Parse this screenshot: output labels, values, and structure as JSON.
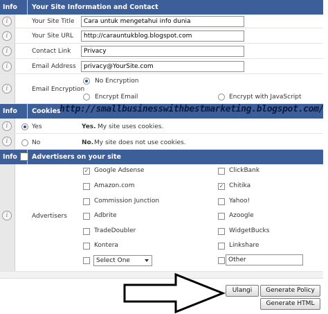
{
  "site_info": {
    "header_info": "Info",
    "header_title": "Your Site Information and Contact",
    "site_title_label": "Your Site Title",
    "site_title_value": "Cara untuk mengetahui info dunia",
    "site_url_label": "Your Site URL",
    "site_url_value": "http://carauntukblog.blogspot.com",
    "contact_link_label": "Contact Link",
    "contact_link_value": "Privacy",
    "email_label": "Email Address",
    "email_value": "privacy@YourSite.com",
    "encryption_label": "Email Encryption",
    "encryption_options": [
      "No Encryption",
      "Encrypt Email",
      "Encrypt with JavaScript"
    ],
    "encryption_selected": "No Encryption"
  },
  "cookies": {
    "header_info": "Info",
    "header_title": "Cookies",
    "yes_label": "Yes",
    "yes_bold": "Yes.",
    "yes_desc": "My site uses cookies.",
    "no_label": "No",
    "no_bold": "No.",
    "no_desc": "My site does not use cookies.",
    "selected": "Yes"
  },
  "watermark": "http://smallbusinesswithbestmarketing.blogspot.com/",
  "advertisers": {
    "header_info": "Info",
    "header_title": "Advertisers on your site",
    "row_label": "Advertisers",
    "left": [
      {
        "name": "Google Adsense",
        "checked": true
      },
      {
        "name": "Amazon.com",
        "checked": false
      },
      {
        "name": "Commission Junction",
        "checked": false
      },
      {
        "name": "Adbrite",
        "checked": false
      },
      {
        "name": "TradeDoubler",
        "checked": false
      },
      {
        "name": "Kontera",
        "checked": false
      }
    ],
    "right": [
      {
        "name": "ClickBank",
        "checked": false
      },
      {
        "name": "Chitika",
        "checked": true
      },
      {
        "name": "Yahoo!",
        "checked": false
      },
      {
        "name": "Azoogle",
        "checked": false
      },
      {
        "name": "WidgetBucks",
        "checked": false
      },
      {
        "name": "Linkshare",
        "checked": false
      }
    ],
    "select_value": "Select One",
    "other_value": "Other"
  },
  "buttons": {
    "reset": "Ulangi",
    "generate_policy": "Generate Policy",
    "generate_html": "Generate HTML"
  },
  "icons": {
    "info": "info-icon",
    "arrow": "right-arrow-icon"
  }
}
